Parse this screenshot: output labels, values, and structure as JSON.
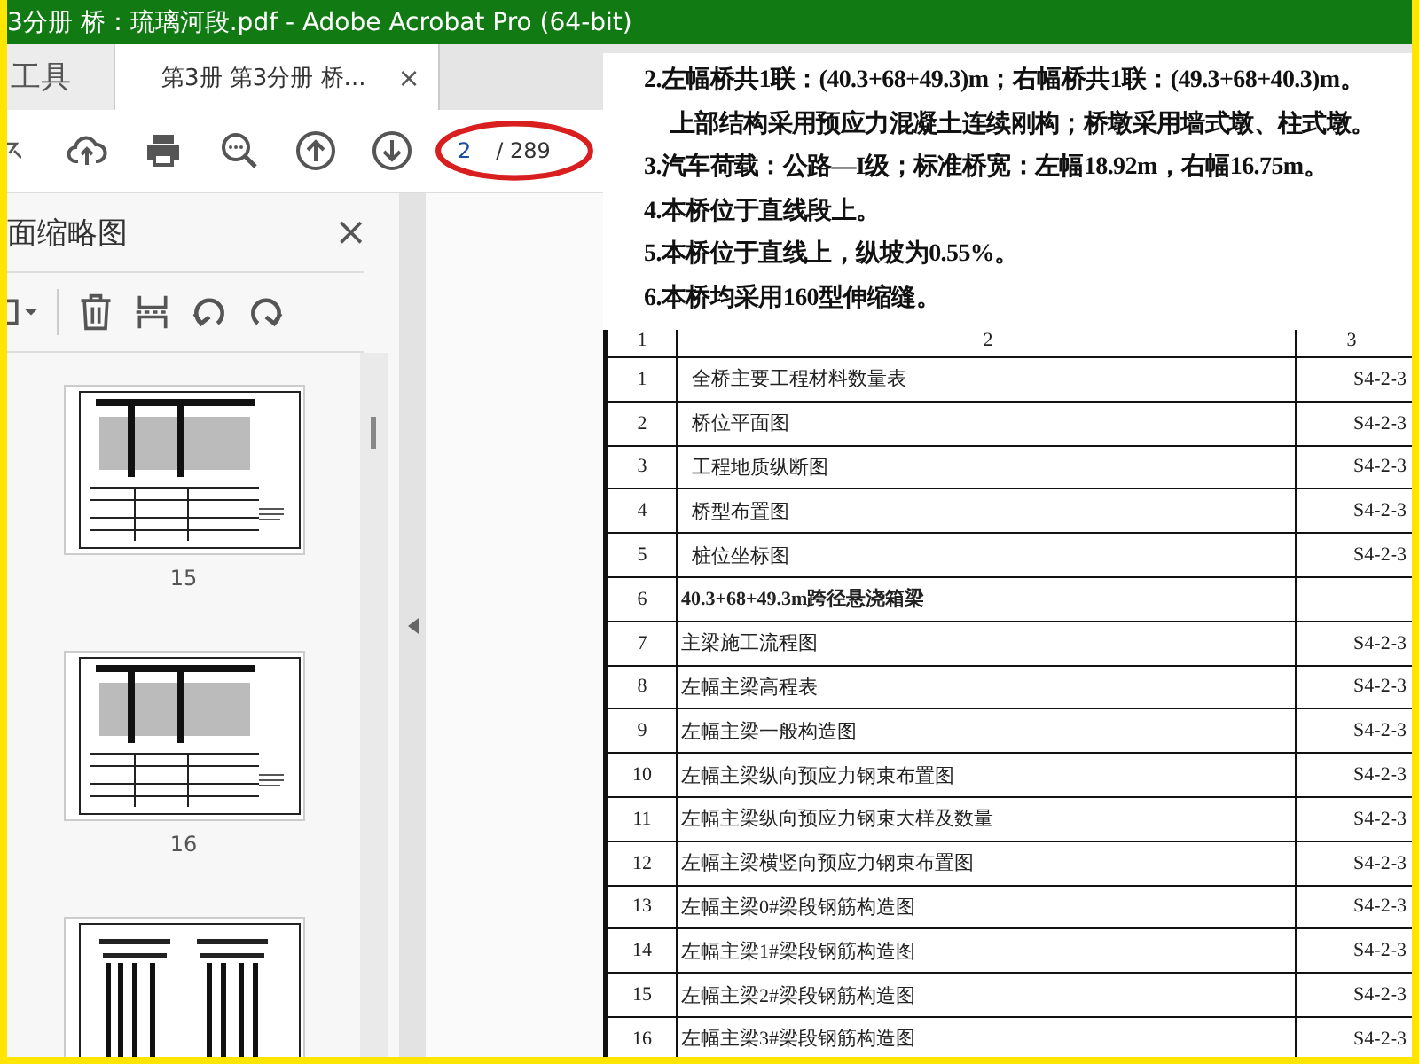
{
  "window": {
    "title": "3分册 桥：琉璃河段.pdf - Adobe Acrobat Pro (64-bit)"
  },
  "tabs": [
    {
      "label": "工具",
      "selected": false
    },
    {
      "label": "第3册 第3分册 桥...",
      "selected": true,
      "close": "×"
    }
  ],
  "toolbar": {
    "page_field": "2",
    "page_total": "/ 289",
    "highlighted": true
  },
  "thumbnail_panel": {
    "title": "面缩略图",
    "close": "×",
    "thumbnails": [
      {
        "label": "15",
        "kind": "elevation"
      },
      {
        "label": "16",
        "kind": "elevation"
      },
      {
        "kind": "piers"
      }
    ]
  },
  "document": {
    "notes": [
      "2.左幅桥共1联：(40.3+68+49.3)m；右幅桥共1联：(49.3+68+40.3)m。",
      "上部结构采用预应力混凝土连续刚构；桥墩采用墙式墩、柱式墩。",
      "3.汽车荷载：公路—I级；标准桥宽：左幅18.92m，右幅16.75m。",
      "4.本桥位于直线段上。",
      "5.本桥位于直线上，纵坡为0.55%。",
      "6.本桥均采用160型伸缩缝。"
    ],
    "table": {
      "columns": [
        "1",
        "2",
        "3"
      ],
      "rows": [
        {
          "no": "1",
          "title": "全桥主要工程材料数量表",
          "code": "S4-2-3",
          "kind": "sub"
        },
        {
          "no": "2",
          "title": "桥位平面图",
          "code": "S4-2-3",
          "kind": "sub"
        },
        {
          "no": "3",
          "title": "工程地质纵断图",
          "code": "S4-2-3",
          "kind": "sub"
        },
        {
          "no": "4",
          "title": "桥型布置图",
          "code": "S4-2-3",
          "kind": "sub"
        },
        {
          "no": "5",
          "title": "桩位坐标图",
          "code": "S4-2-3",
          "kind": "sub"
        },
        {
          "no": "6",
          "title": "40.3+68+49.3m跨径悬浇箱梁",
          "code": null,
          "kind": "section"
        },
        {
          "no": "7",
          "title": "主梁施工流程图",
          "code": "S4-2-3",
          "kind": "item"
        },
        {
          "no": "8",
          "title": "左幅主梁高程表",
          "code": "S4-2-3",
          "kind": "item"
        },
        {
          "no": "9",
          "title": "左幅主梁一般构造图",
          "code": "S4-2-3",
          "kind": "item"
        },
        {
          "no": "10",
          "title": "左幅主梁纵向预应力钢束布置图",
          "code": "S4-2-3",
          "kind": "item"
        },
        {
          "no": "11",
          "title": "左幅主梁纵向预应力钢束大样及数量",
          "code": "S4-2-3",
          "kind": "item"
        },
        {
          "no": "12",
          "title": "左幅主梁横竖向预应力钢束布置图",
          "code": "S4-2-3",
          "kind": "item"
        },
        {
          "no": "13",
          "title": "左幅主梁0#梁段钢筋构造图",
          "code": "S4-2-3",
          "kind": "item"
        },
        {
          "no": "14",
          "title": "左幅主梁1#梁段钢筋构造图",
          "code": "S4-2-3",
          "kind": "item"
        },
        {
          "no": "15",
          "title": "左幅主梁2#梁段钢筋构造图",
          "code": "S4-2-3",
          "kind": "item"
        },
        {
          "no": "16",
          "title": "左幅主梁3#梁段钢筋构造图",
          "code": "S4-2-3",
          "kind": "item"
        }
      ]
    }
  }
}
